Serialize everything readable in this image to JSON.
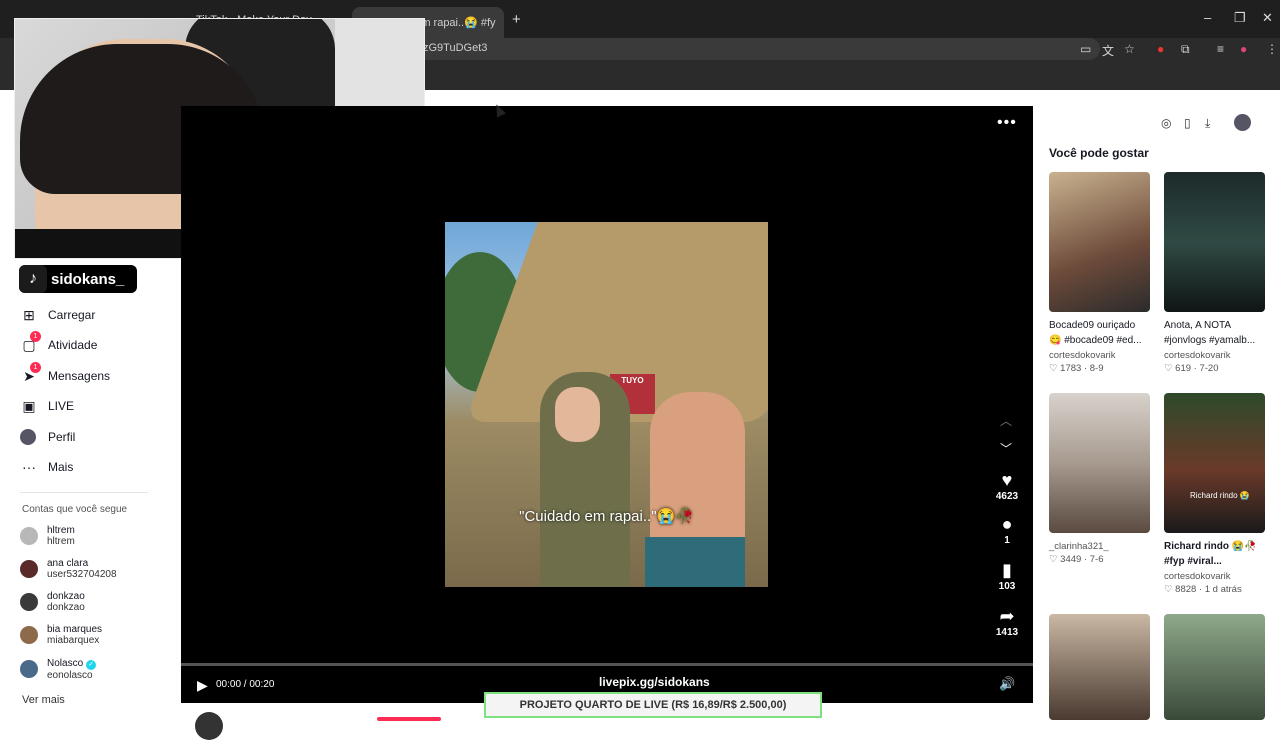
{
  "browser": {
    "tabs": [
      {
        "label": "...",
        "active": false
      },
      {
        "label": "TikTok - Make Your Day",
        "active": false
      },
      {
        "label": "@Cuidado em rapai..😭 #fy",
        "active": true
      }
    ],
    "new_tab": "+",
    "url": "zG9TuDGet3",
    "window_controls": [
      "–",
      "❐",
      "✕"
    ]
  },
  "sidebar": {
    "brand": "sidokans_",
    "nav": [
      {
        "label": "Carregar",
        "icon": "upload-icon",
        "badge": ""
      },
      {
        "label": "Atividade",
        "icon": "activity-icon",
        "badge": "1"
      },
      {
        "label": "Mensagens",
        "icon": "messages-icon",
        "badge": "1"
      },
      {
        "label": "LIVE",
        "icon": "live-icon",
        "badge": ""
      },
      {
        "label": "Perfil",
        "icon": "profile-icon",
        "badge": ""
      },
      {
        "label": "Mais",
        "icon": "more-icon",
        "badge": ""
      }
    ],
    "following_title": "Contas que você segue",
    "following": [
      {
        "name": "hltrem",
        "handle": "hltrem",
        "verified": false
      },
      {
        "name": "ana clara",
        "handle": "user532704208",
        "verified": false
      },
      {
        "name": "donkzao",
        "handle": "donkzao",
        "verified": false
      },
      {
        "name": "bia marques",
        "handle": "miabarquex",
        "verified": false
      },
      {
        "name": "Nolasco",
        "handle": "eonolasco",
        "verified": true
      }
    ],
    "see_more": "Ver mais"
  },
  "player": {
    "subtitle": "\"Cuidado em rapai..\"😭🥀",
    "sign_text": "TUYO",
    "likes": "4623",
    "comments": "1",
    "saves": "103",
    "shares": "1413",
    "time": "00:00 / 00:20",
    "overlay_link": "livepix.gg/sidokans",
    "banner": "PROJETO QUARTO DE LIVE (R$ 16,89/R$ 2.500,00)"
  },
  "recommendations": {
    "title": "Você pode gostar",
    "items": [
      {
        "caption": "Bocade09 ouriçado 😋 #bocade09 #ed...",
        "author": "cortesdokovarik",
        "likes": "1783",
        "date": "8-9",
        "bold": false
      },
      {
        "caption": "Anota, A NOTA #jonvlogs #yamalb...",
        "author": "cortesdokovarik",
        "likes": "619",
        "date": "7-20",
        "bold": false
      },
      {
        "caption": "",
        "author": "_clarinha321_",
        "likes": "3449",
        "date": "7-6",
        "bold": false
      },
      {
        "caption": "Richard rindo 😭🥀 #fyp #viral...",
        "author": "cortesdokovarik",
        "likes": "8828",
        "date": "1 d atrás",
        "bold": true,
        "thumb_text": "Richard rindo 😭"
      }
    ]
  }
}
